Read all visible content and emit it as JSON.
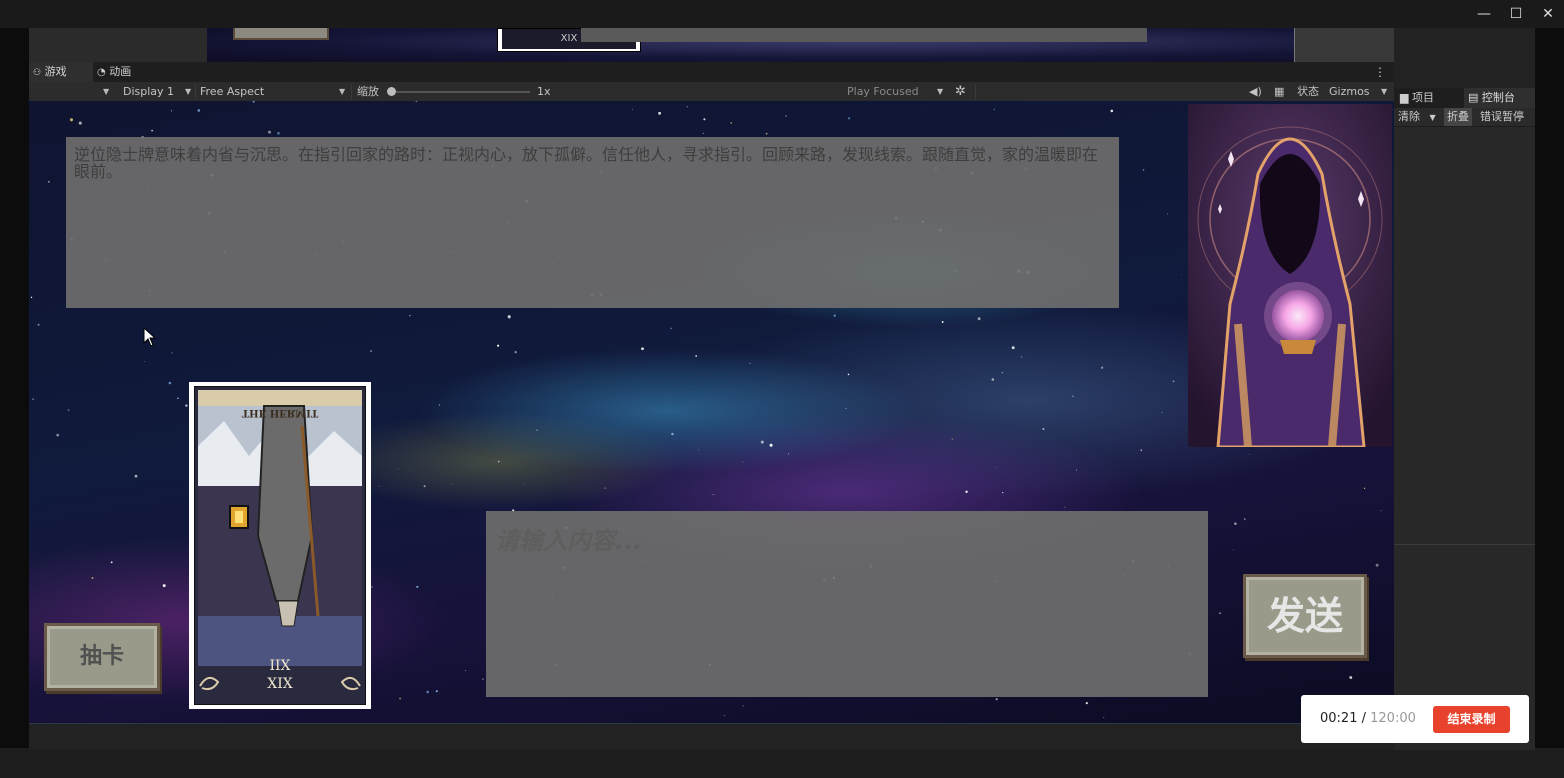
{
  "window": {
    "minimize_label": "—",
    "maximize_label": "☐",
    "close_label": "✕"
  },
  "scene_preview": {
    "card_numeral": "XIX"
  },
  "tabs": {
    "game": "游戏",
    "animation": "动画",
    "more": "⋮"
  },
  "toolbar": {
    "display": "Display 1",
    "aspect": "Free Aspect",
    "zoom_label": "缩放",
    "zoom_value": "1x",
    "zoom_level": 0.0,
    "play_mode": "Play Focused",
    "stats": "状态",
    "gizmos": "Gizmos"
  },
  "right_panel": {
    "tab_project": "项目",
    "tab_console": "控制台",
    "clear": "清除",
    "collapse": "折叠",
    "error_pause": "错误暂停"
  },
  "game": {
    "reading_text": "逆位隐士牌意味着内省与沉思。在指引回家的路时：正视内心，放下孤僻。信任他人，寻求指引。回顾来路，发现线索。跟随直觉，家的温暖即在眼前。",
    "tarot_card": {
      "title": "THE HERMIT",
      "numeral_top": "IIX",
      "numeral_bottom": "XIX",
      "reversed": true
    },
    "input_placeholder": "请输入内容...",
    "draw_button": "抽卡",
    "send_button": "发送"
  },
  "recorder": {
    "elapsed": "00:21",
    "separator": "/",
    "total": "120:00",
    "stop_button": "结束录制"
  },
  "colors": {
    "record_red": "#e8412c",
    "panel_gray": "#6e6e6e"
  }
}
